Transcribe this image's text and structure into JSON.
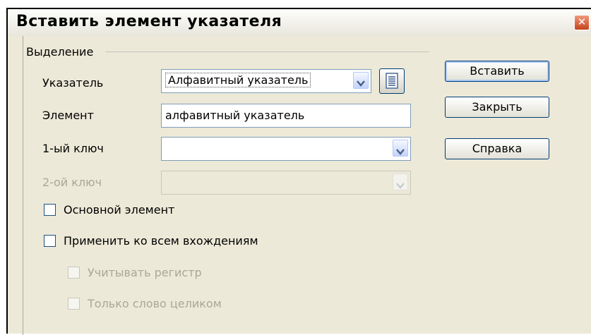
{
  "dialog": {
    "title": "Вставить элемент указателя",
    "close_glyph": "✕"
  },
  "selection_group": {
    "legend": "Выделение",
    "index_label": "Указатель",
    "index_value": "Алфавитный указатель",
    "entry_label": "Элемент",
    "entry_value": "алфавитный указатель",
    "key1_label": "1-ый ключ",
    "key1_value": "",
    "key2_label": "2-ой ключ",
    "key2_value": "",
    "main_entry_label": "Основной элемент",
    "main_entry_checked": false,
    "apply_all_label": "Применить ко всем вхождениям",
    "apply_all_checked": false,
    "match_case_label": "Учитывать регистр",
    "whole_words_label": "Только слово целиком"
  },
  "buttons": {
    "insert_label": "Вставить",
    "close_label": "Закрыть",
    "help_label": "Справка"
  },
  "icons": {
    "new_index": "list-document-icon",
    "dropdown": "chevron-down-icon",
    "close": "close-icon"
  },
  "colors": {
    "dialog_bg": "#ece9d8",
    "field_border": "#7f9db9",
    "button_border": "#003c74",
    "close_button": "#c4441c",
    "disabled_text": "#a8a898"
  }
}
